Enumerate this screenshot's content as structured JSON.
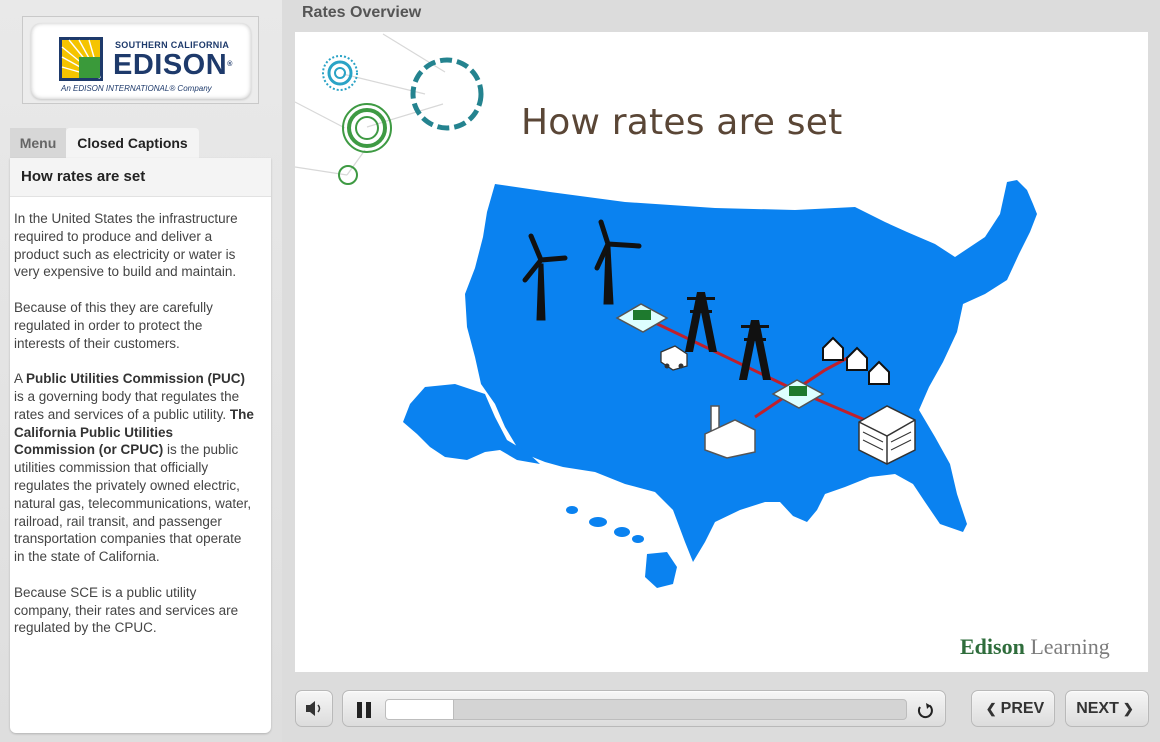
{
  "logo": {
    "top_line": "SOUTHERN CALIFORNIA",
    "main": "EDISON",
    "registered": "®",
    "sub": "An EDISON INTERNATIONAL® Company"
  },
  "sidebar": {
    "tabs": [
      {
        "label": "Menu"
      },
      {
        "label": "Closed Captions"
      }
    ],
    "panel_title": "How rates are set",
    "captions": {
      "p1": "In the United States the infrastructure required to produce and deliver a product such as electricity or water is very expensive to build and maintain.",
      "p2": "Because of this they are carefully regulated in order to protect the interests of their customers.",
      "p3_a": "A ",
      "p3_b": "Public Utilities Commission (PUC)",
      "p3_c": " is a governing body that regulates the rates and services of a public utility. ",
      "p3_d": "The California Public Utilities Commission (or CPUC)",
      "p3_e": " is the public utilities commission that officially regulates the privately owned electric, natural gas, telecommunications, water, railroad, rail transit, and passenger transportation companies that operate in the state of California.",
      "p4": "Because SCE is a public utility company, their rates and services are regulated by the CPUC."
    }
  },
  "stage": {
    "title": "Rates Overview",
    "slide_heading": "How rates are set",
    "brand_a": "Edison",
    "brand_b": " Learning"
  },
  "controls": {
    "prev_label": "PREV",
    "next_label": "NEXT",
    "progress_fraction": 0.13,
    "icons": [
      "speaker-icon",
      "pause-icon",
      "replay-icon",
      "chevron-left-icon",
      "chevron-right-icon"
    ]
  },
  "colors": {
    "map_blue": "#0a82f0",
    "power_line": "#c0202c",
    "teal": "#24838f",
    "green": "#3e9a43",
    "heading_brown": "#5a4636"
  }
}
